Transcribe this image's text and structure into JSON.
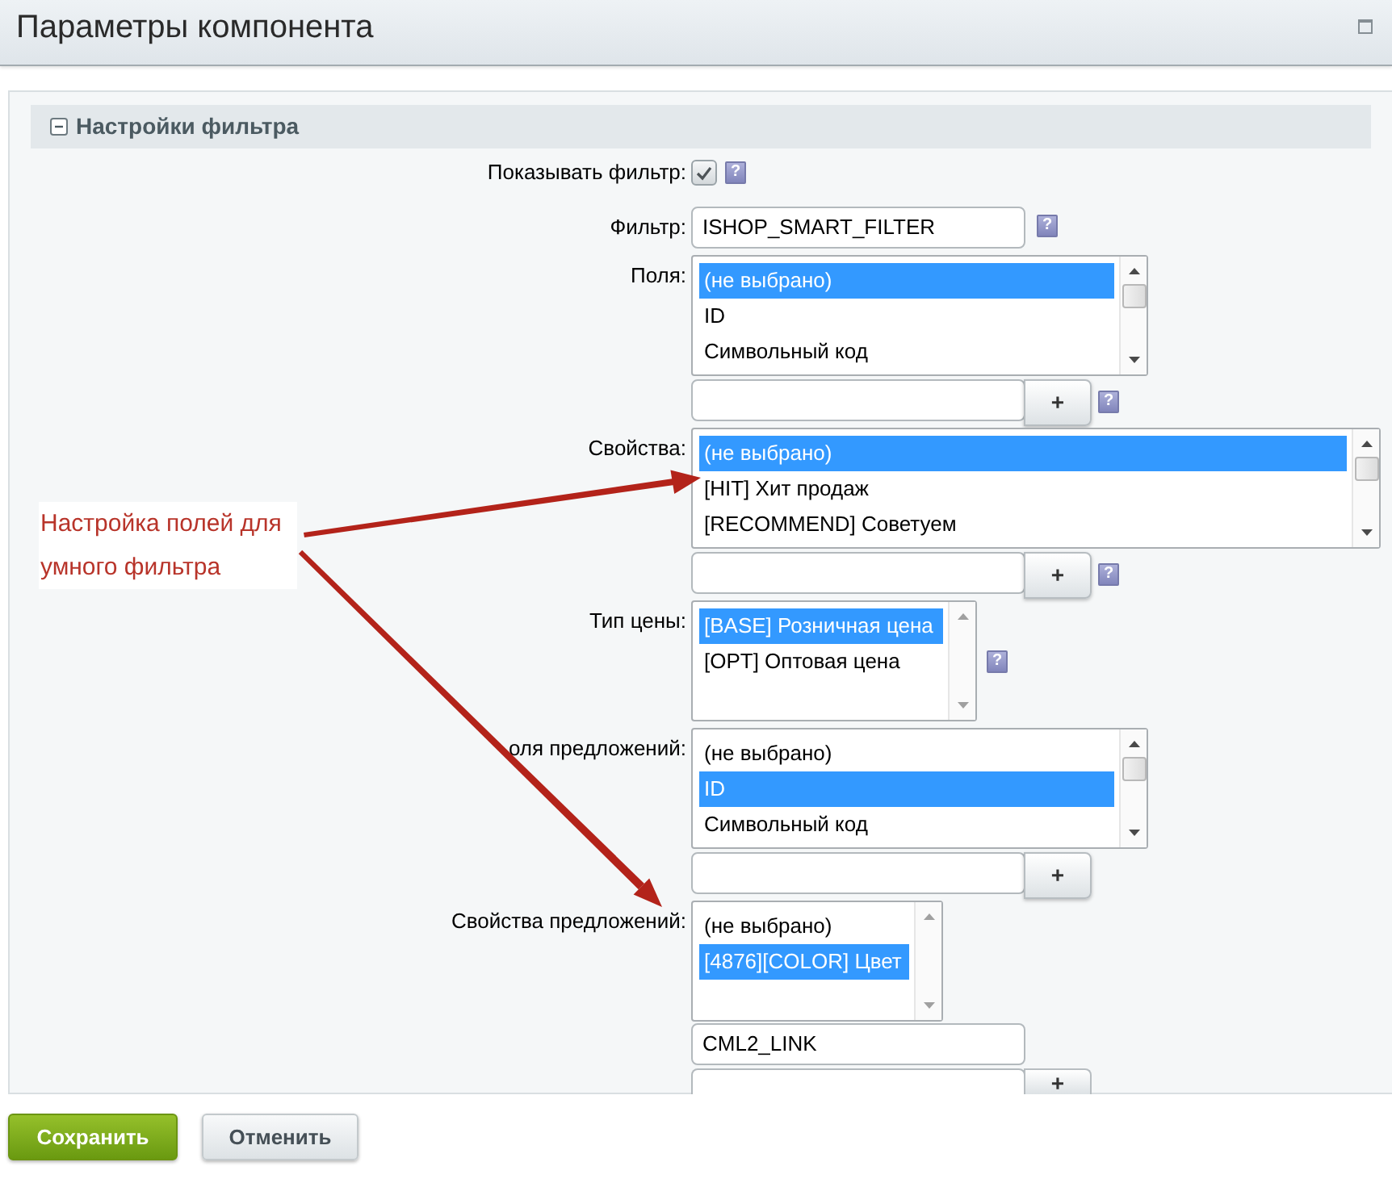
{
  "window": {
    "title": "Параметры компонента"
  },
  "section": {
    "title": "Настройки фильтра",
    "expanded": true
  },
  "fields": [
    {
      "kind": "checkbox",
      "label": "Показывать фильтр:",
      "checked": true,
      "help": "?"
    },
    {
      "kind": "text",
      "label": "Фильтр:",
      "value": "ISHOP_SMART_FILTER",
      "help": "?"
    },
    {
      "kind": "list",
      "label": "Поля:",
      "options": [
        {
          "text": "(не выбрано)",
          "selected": true
        },
        {
          "text": "ID",
          "selected": false
        },
        {
          "text": "Символьный код",
          "selected": false
        }
      ],
      "add_row": {
        "button": "+",
        "help": "?"
      }
    },
    {
      "kind": "list",
      "label": "Свойства:",
      "options": [
        {
          "text": "(не выбрано)",
          "selected": true
        },
        {
          "text": "[HIT] Хит продаж",
          "selected": false
        },
        {
          "text": "[RECOMMEND] Советуем",
          "selected": false
        }
      ],
      "add_row": {
        "button": "+",
        "help": "?"
      }
    },
    {
      "kind": "list",
      "label": "Тип цены:",
      "options": [
        {
          "text": "[BASE] Розничная цена",
          "selected": true
        },
        {
          "text": "[OPT] Оптовая цена",
          "selected": false
        }
      ],
      "help": "?"
    },
    {
      "kind": "list",
      "label": "оля предложений:",
      "options": [
        {
          "text": "(не выбрано)",
          "selected": false
        },
        {
          "text": "ID",
          "selected": true
        },
        {
          "text": "Символьный код",
          "selected": false
        }
      ],
      "add_row": {
        "button": "+"
      }
    },
    {
      "kind": "list",
      "label": "Свойства предложений:",
      "options": [
        {
          "text": "(не выбрано)",
          "selected": false
        },
        {
          "text": "[4876][COLOR] Цвет",
          "selected": true
        }
      ],
      "values": [
        "CML2_LINK"
      ],
      "add_row": {
        "button": "+"
      }
    }
  ],
  "annotation": {
    "text": "Настройка полей для умного фильтра"
  },
  "buttons": [
    {
      "kind": "primary",
      "label": "Сохранить"
    },
    {
      "kind": "secondary",
      "label": "Отменить"
    }
  ]
}
